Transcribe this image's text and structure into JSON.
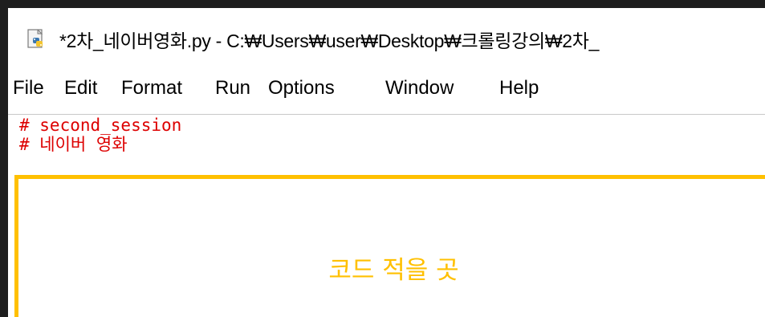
{
  "window": {
    "title": "*2차_네이버영화.py - C:₩Users₩user₩Desktop₩크롤링강의₩2차_"
  },
  "menu": {
    "items": [
      "File",
      "Edit",
      "Format",
      "Run",
      "Options",
      "Window",
      "Help"
    ]
  },
  "editor": {
    "lines": [
      "# second_session",
      "# 네이버 영화"
    ]
  },
  "annotation": {
    "label": "코드 적을 곳",
    "color": "#ffc000"
  },
  "colors": {
    "comment": "#dd0000",
    "background_dark": "#1e1e1e"
  },
  "icons": {
    "app": "python-file-icon"
  }
}
